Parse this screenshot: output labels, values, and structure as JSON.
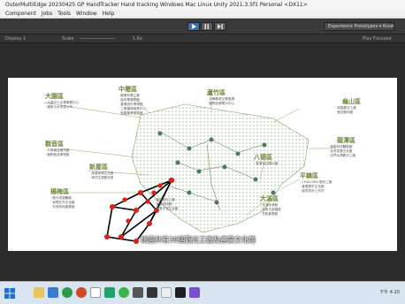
{
  "window": {
    "title": "OuterMultiEdge 20230425 GP HandTracker Hand tracking Windows Mac Linux Unity 2021.3.5f1 Personal <DX11>"
  },
  "menu": {
    "items": [
      "Component",
      "Jobs",
      "Tools",
      "Window",
      "Help"
    ]
  },
  "toolbar": {
    "layout_label": "Experience Prototypes ▾ Kiosk ▾"
  },
  "gameview": {
    "display": "Display 1",
    "scale_label": "Scale",
    "scale_value": "1.6x",
    "maximize": "Play Focused"
  },
  "infographic": {
    "regions": [
      {
        "name": "大園區",
        "items": [
          "· 大園中小企業服務中心",
          "· 國家污水資源公司"
        ]
      },
      {
        "name": "中壢區",
        "items": [
          "· 龍崗形象工廠",
          "· 製茶業展覽館",
          "· 產業設計博物館",
          "· 工業攤商推廣中心",
          "· 瓶蓋產業發展館"
        ]
      },
      {
        "name": "蘆竹區",
        "items": [
          "· 中華郵政文教推廣",
          "· 國際品牌展示中心"
        ]
      },
      {
        "name": "龜山區",
        "items": [
          "· 桃園觀光工廠",
          "· 食品飲料館"
        ]
      },
      {
        "name": "龍潭區",
        "items": [
          "· 綠能科技體驗館",
          "· 台灣茶業文化館",
          "· 石門水庫觀光工廠"
        ]
      },
      {
        "name": "觀音區",
        "items": [
          "· 平鎮織品陳列館",
          "· 國際藝品博物館"
        ]
      },
      {
        "name": "新屋區",
        "items": [
          "· 漁港休閒文化館",
          "· 海洋生態觀光區"
        ]
      },
      {
        "name": "八德區",
        "items": [
          "· 智慧科技展示館"
        ]
      },
      {
        "name": "平鎮區",
        "items": [
          "· CHIA-HSIN 觀光工廠",
          "· 產業歷史文化館",
          "· 創意設計工作坊"
        ]
      },
      {
        "name": "楊梅區",
        "items": [
          "· 觀光茶園體驗",
          "· 休閒花卉文化館",
          "· 在地特色產業館"
        ]
      },
      {
        "name": "大溪區",
        "items": [
          "· 大溪木藝館",
          "· 老街文創園區",
          "· 豆乾產業館"
        ]
      }
    ],
    "center_items": [
      "· 桃園觀光工廠",
      "· 食品科技館",
      "· 產業文化生活館"
    ],
    "subtitle": "桃園共有39個觀光工廠及產業文化館"
  },
  "taskbar": {
    "time": "下午 4:20"
  }
}
